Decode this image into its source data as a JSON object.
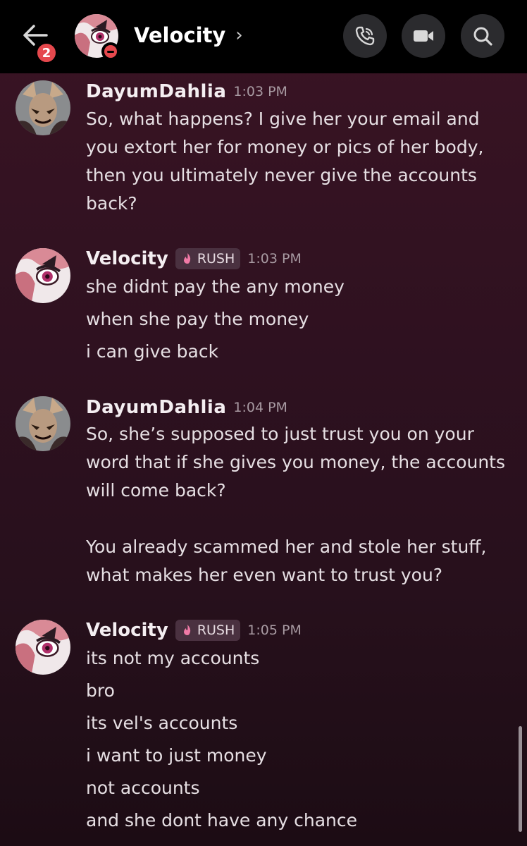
{
  "header": {
    "unread_badge": "2",
    "title": "Velocity",
    "chevron": "›",
    "icons": {
      "back": "arrow-left-icon",
      "call": "phone-call-icon",
      "video": "video-camera-icon",
      "search": "search-icon"
    }
  },
  "messages": [
    {
      "author": "DayumDahlia",
      "time": "1:03 PM",
      "lines": [
        "So, what happens? I give her your email and",
        "you extort her for money or pics of her body,",
        "then you ultimately never give the accounts",
        "back?"
      ]
    },
    {
      "author": "Velocity",
      "tag": "RUSH",
      "time": "1:03 PM",
      "lines": [
        "she didnt pay the any money",
        "when she pay the money",
        "i can give back"
      ]
    },
    {
      "author": "DayumDahlia",
      "time": "1:04 PM",
      "lines": [
        "So, she’s supposed to just trust you on your",
        "word that if she gives you money, the accounts",
        "will come back?",
        "You already scammed her and stole her stuff,",
        "what makes her even want to trust you?"
      ]
    },
    {
      "author": "Velocity",
      "tag": "RUSH",
      "time": "1:05 PM",
      "lines": [
        "its not my accounts",
        "bro",
        "its vel's accounts",
        "i want to just money",
        "not accounts",
        "and she dont have any chance"
      ]
    }
  ],
  "colors": {
    "accent_red": "#e5484d",
    "tag_bg": "#4a3140",
    "background_top": "#3a1424",
    "background_bottom": "#1c0c14"
  }
}
